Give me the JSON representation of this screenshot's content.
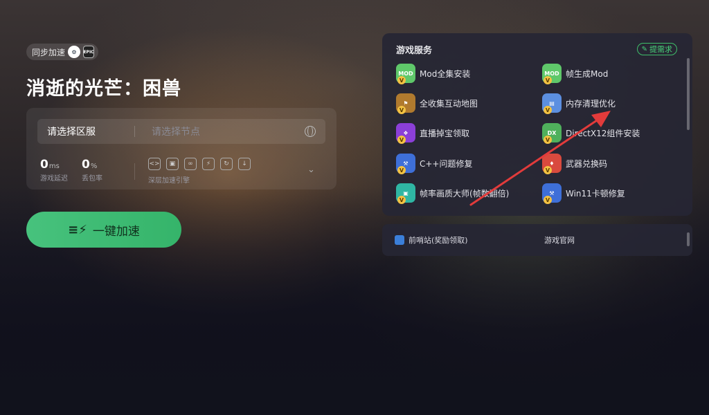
{
  "platform": {
    "label": "同步加速",
    "icons": [
      "steam-icon",
      "epic-icon"
    ]
  },
  "game": {
    "title": "消逝的光芒：困兽"
  },
  "selector": {
    "region": "请选择区服",
    "node_placeholder": "请选择节点"
  },
  "stats": {
    "latency": {
      "value": "0",
      "unit": "ms",
      "label": "游戏延迟"
    },
    "loss": {
      "value": "0",
      "unit": "%",
      "label": "丢包率"
    },
    "engine_label": "深层加速引擎"
  },
  "accelerate": {
    "label": "一键加速"
  },
  "services": {
    "title": "游戏服务",
    "request_label": "提需求",
    "items": [
      {
        "label": "Mod全集安装",
        "icon": "mod-icon",
        "color": "#5fc86a"
      },
      {
        "label": "帧生成Mod",
        "icon": "mod-icon",
        "color": "#5fc86a"
      },
      {
        "label": "全收集互动地图",
        "icon": "map-icon",
        "color": "#b07a2e"
      },
      {
        "label": "内存清理优化",
        "icon": "memory-icon",
        "color": "#5c8fe0"
      },
      {
        "label": "直播掉宝领取",
        "icon": "gift-icon",
        "color": "#8b3fd8"
      },
      {
        "label": "DirectX12组件安装",
        "icon": "directx-icon",
        "color": "#4fb05c"
      },
      {
        "label": "C++问题修复",
        "icon": "wrench-icon",
        "color": "#3e6fd8"
      },
      {
        "label": "武器兑换码",
        "icon": "card-icon",
        "color": "#d94a3e"
      },
      {
        "label": "帧率画质大师(帧数翻倍)",
        "icon": "fps-icon",
        "color": "#2fb6a3"
      },
      {
        "label": "Win11卡顿修复",
        "icon": "wrench-icon",
        "color": "#3e6fd8"
      }
    ]
  },
  "links": {
    "outpost": "前哨站(奖励领取)",
    "official": "游戏官网"
  },
  "colors": {
    "accent_green": "#3fbf6a",
    "arrow_red": "#e23b3b"
  }
}
